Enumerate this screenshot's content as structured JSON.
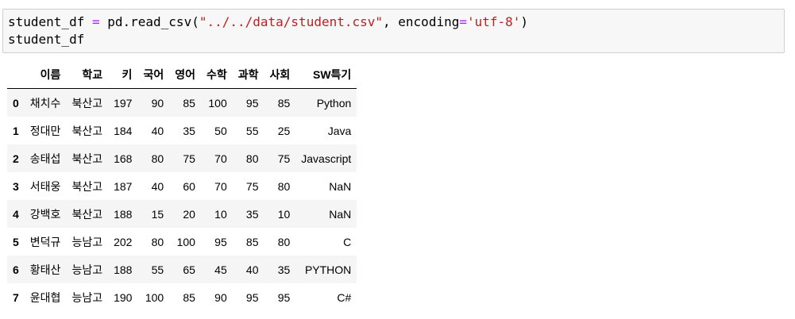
{
  "code": {
    "var": "student_df",
    "op": " = ",
    "call": "pd.read_csv(",
    "path": "\"../../data/student.csv\"",
    "sep": ", encoding",
    "eq": "=",
    "enc": "'utf-8'",
    "close": ")",
    "line2": "student_df"
  },
  "table": {
    "columns": [
      "",
      "이름",
      "학교",
      "키",
      "국어",
      "영어",
      "수학",
      "과학",
      "사회",
      "SW특기"
    ],
    "rows": [
      {
        "index": "0",
        "cells": [
          "채치수",
          "북산고",
          "197",
          "90",
          "85",
          "100",
          "95",
          "85",
          "Python"
        ]
      },
      {
        "index": "1",
        "cells": [
          "정대만",
          "북산고",
          "184",
          "40",
          "35",
          "50",
          "55",
          "25",
          "Java"
        ]
      },
      {
        "index": "2",
        "cells": [
          "송태섭",
          "북산고",
          "168",
          "80",
          "75",
          "70",
          "80",
          "75",
          "Javascript"
        ]
      },
      {
        "index": "3",
        "cells": [
          "서태웅",
          "북산고",
          "187",
          "40",
          "60",
          "70",
          "75",
          "80",
          "NaN"
        ]
      },
      {
        "index": "4",
        "cells": [
          "강백호",
          "북산고",
          "188",
          "15",
          "20",
          "10",
          "35",
          "10",
          "NaN"
        ]
      },
      {
        "index": "5",
        "cells": [
          "변덕규",
          "능남고",
          "202",
          "80",
          "100",
          "95",
          "85",
          "80",
          "C"
        ]
      },
      {
        "index": "6",
        "cells": [
          "황태산",
          "능남고",
          "188",
          "55",
          "65",
          "45",
          "40",
          "35",
          "PYTHON"
        ]
      },
      {
        "index": "7",
        "cells": [
          "윤대협",
          "능남고",
          "190",
          "100",
          "85",
          "90",
          "95",
          "95",
          "C#"
        ]
      }
    ]
  }
}
